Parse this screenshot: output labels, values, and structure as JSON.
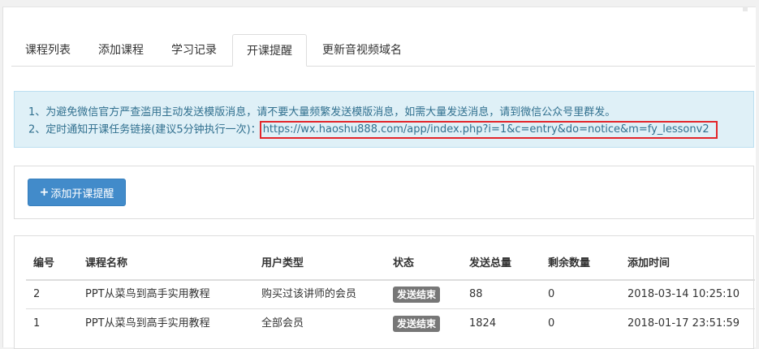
{
  "tabs": [
    {
      "label": "课程列表"
    },
    {
      "label": "添加课程"
    },
    {
      "label": "学习记录"
    },
    {
      "label": "开课提醒",
      "active": true
    },
    {
      "label": "更新音视频域名"
    }
  ],
  "notice": {
    "line1": "1、为避免微信官方严查滥用主动发送模版消息，请不要大量频繁发送模版消息，如需大量发送消息，请到微信公众号里群发。",
    "line2_prefix": "2、定时通知开课任务链接(建议5分钟执行一次)：",
    "link": "https://wx.haoshu888.com/app/index.php?i=1&c=entry&do=notice&m=fy_lessonv2"
  },
  "add_button": {
    "plus": "+",
    "label": "添加开课提醒"
  },
  "table": {
    "headers": [
      "编号",
      "课程名称",
      "用户类型",
      "状态",
      "发送总量",
      "剩余数量",
      "添加时间"
    ],
    "rows": [
      [
        "2",
        "PPT从菜鸟到高手实用教程",
        "购买过该讲师的会员",
        "发送结束",
        "88",
        "0",
        "2018-03-14 10:25:10"
      ],
      [
        "1",
        "PPT从菜鸟到高手实用教程",
        "全部会员",
        "发送结束",
        "1824",
        "0",
        "2018-01-17 23:51:59"
      ]
    ]
  },
  "colors": {
    "accent": "#428bca",
    "notice_bg": "#dff0f7",
    "highlight": "#e3262a",
    "badge": "#777777"
  }
}
